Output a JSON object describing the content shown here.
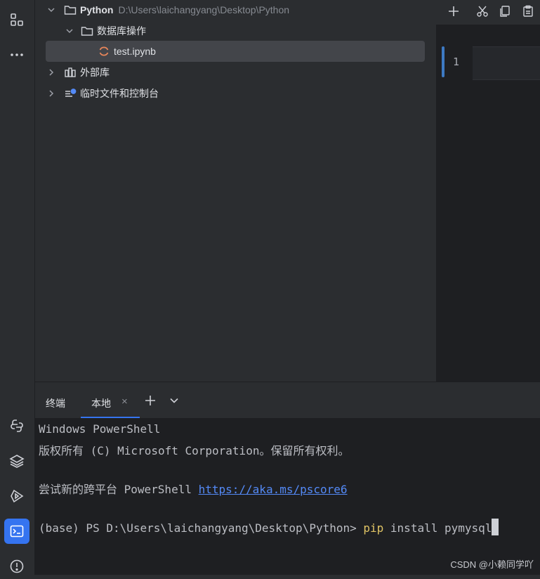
{
  "colors": {
    "accent": "#3574f0",
    "bg_panel": "#2b2d30",
    "bg_editor": "#1e1f22",
    "link": "#548af7",
    "command": "#e0c465",
    "notebook_icon": "#e8865a"
  },
  "activity_bar": {
    "items": [
      {
        "icon": "structure-icon"
      },
      {
        "icon": "more-icon"
      },
      {
        "icon": "python-console-icon"
      },
      {
        "icon": "layers-icon"
      },
      {
        "icon": "run-icon"
      },
      {
        "icon": "terminal-icon",
        "active": true
      },
      {
        "icon": "problems-icon"
      }
    ]
  },
  "project_tree": {
    "root": {
      "label": "Python",
      "path": "D:\\Users\\laichangyang\\Desktop\\Python"
    },
    "folder": {
      "label": "数据库操作"
    },
    "file": {
      "label": "test.ipynb"
    },
    "external_libs": {
      "label": "外部库"
    },
    "scratches": {
      "label": "临时文件和控制台"
    }
  },
  "editor": {
    "line_number": "1",
    "toolbar": [
      "add-icon",
      "cut-icon",
      "copy-icon",
      "paste-icon"
    ]
  },
  "terminal": {
    "title": "终端",
    "tab_label": "本地",
    "tab_close": "×",
    "lines": {
      "l1": "Windows PowerShell",
      "l2": "版权所有 (C) Microsoft Corporation。保留所有权利。",
      "l3_prefix": "尝试新的跨平台 PowerShell ",
      "l3_link": "https://aka.ms/pscore6",
      "l4_prompt": "(base) PS D:\\Users\\laichangyang\\Desktop\\Python> ",
      "l4_cmd": "pip",
      "l4_args": " install pymysql"
    }
  },
  "watermark": "CSDN @小赖同学吖"
}
